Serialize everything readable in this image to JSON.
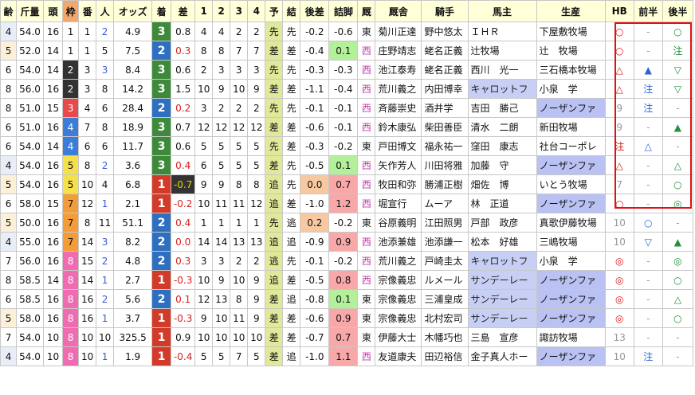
{
  "headers": [
    "齢",
    "斤量",
    "頭",
    "枠",
    "番",
    "人",
    "オッズ",
    "着",
    "差",
    "1",
    "2",
    "3",
    "4",
    "予",
    "結",
    "後差",
    "詰脚",
    "厩",
    "厩舎",
    "騎手",
    "馬主",
    "生産",
    "HB",
    "前半",
    "後半"
  ],
  "rows": [
    {
      "age": "4",
      "kin": "54.0",
      "to": "16",
      "waku": "1",
      "ban": "1",
      "nin": "2",
      "odds": "4.9",
      "chaku": "3",
      "sa": "0.8",
      "c1": "4",
      "c2": "4",
      "c3": "2",
      "c4": "2",
      "yo": "先",
      "ke": "先",
      "kosa": "-0.2",
      "tsume": "-0.6",
      "umaya": "東",
      "kyu": "菊川正達",
      "kishu": "野中悠太",
      "banushi": "ＩＨＲ",
      "seisan": "下屋敷牧場",
      "hb": "○",
      "zen": "-",
      "kou": "○"
    },
    {
      "age": "5",
      "kin": "52.0",
      "to": "14",
      "waku": "1",
      "ban": "1",
      "nin": "5",
      "odds": "7.5",
      "chaku": "2",
      "sa": "0.3",
      "c1": "8",
      "c2": "8",
      "c3": "7",
      "c4": "7",
      "yo": "差",
      "ke": "差",
      "kosa": "-0.4",
      "tsume": "0.1",
      "umaya": "西",
      "kyu": "庄野靖志",
      "kishu": "蛯名正義",
      "banushi": "辻牧場",
      "seisan": "辻　牧場",
      "hb": "○",
      "zen": "-",
      "kou": "注"
    },
    {
      "age": "6",
      "kin": "54.0",
      "to": "14",
      "waku": "2",
      "ban": "3",
      "nin": "3",
      "odds": "8.4",
      "chaku": "3",
      "sa": "0.6",
      "c1": "2",
      "c2": "3",
      "c3": "3",
      "c4": "3",
      "yo": "先",
      "ke": "先",
      "kosa": "-0.3",
      "tsume": "-0.3",
      "umaya": "西",
      "kyu": "池江泰寿",
      "kishu": "蛯名正義",
      "banushi": "西川　光一",
      "seisan": "三石橋本牧場",
      "hb": "△",
      "zen": "▲",
      "kou": "▽"
    },
    {
      "age": "8",
      "kin": "56.0",
      "to": "16",
      "waku": "2",
      "ban": "3",
      "nin": "8",
      "odds": "14.2",
      "chaku": "3",
      "sa": "1.5",
      "c1": "10",
      "c2": "9",
      "c3": "10",
      "c4": "9",
      "yo": "差",
      "ke": "差",
      "kosa": "-1.1",
      "tsume": "-0.4",
      "umaya": "西",
      "kyu": "荒川義之",
      "kishu": "内田博幸",
      "banushi": "キャロットフ",
      "seisan": "小泉　学",
      "hb": "△",
      "zen": "注",
      "kou": "▽"
    },
    {
      "age": "8",
      "kin": "51.0",
      "to": "15",
      "waku": "3",
      "ban": "4",
      "nin": "6",
      "odds": "28.4",
      "chaku": "2",
      "sa": "0.2",
      "c1": "3",
      "c2": "2",
      "c3": "2",
      "c4": "2",
      "yo": "先",
      "ke": "先",
      "kosa": "-0.1",
      "tsume": "-0.1",
      "umaya": "西",
      "kyu": "斉藤崇史",
      "kishu": "酒井学",
      "banushi": "吉田　勝己",
      "seisan": "ノーザンファ",
      "hb": "9",
      "zen": "注",
      "kou": "-"
    },
    {
      "age": "6",
      "kin": "51.0",
      "to": "16",
      "waku": "4",
      "ban": "7",
      "nin": "8",
      "odds": "18.9",
      "chaku": "3",
      "sa": "0.7",
      "c1": "12",
      "c2": "12",
      "c3": "12",
      "c4": "12",
      "yo": "差",
      "ke": "差",
      "kosa": "-0.6",
      "tsume": "-0.1",
      "umaya": "西",
      "kyu": "鈴木康弘",
      "kishu": "柴田善臣",
      "banushi": "清水　二朗",
      "seisan": "新田牧場",
      "hb": "9",
      "zen": "-",
      "kou": "▲"
    },
    {
      "age": "6",
      "kin": "54.0",
      "to": "14",
      "waku": "4",
      "ban": "6",
      "nin": "6",
      "odds": "11.7",
      "chaku": "3",
      "sa": "0.6",
      "c1": "5",
      "c2": "5",
      "c3": "5",
      "c4": "5",
      "yo": "先",
      "ke": "差",
      "kosa": "-0.3",
      "tsume": "-0.2",
      "umaya": "東",
      "kyu": "戸田博文",
      "kishu": "福永祐一",
      "banushi": "窪田　康志",
      "seisan": "社台コーポレ",
      "hb": "注",
      "zen": "△",
      "kou": "-"
    },
    {
      "age": "4",
      "kin": "54.0",
      "to": "16",
      "waku": "5",
      "ban": "8",
      "nin": "2",
      "odds": "3.6",
      "chaku": "3",
      "sa": "0.4",
      "c1": "6",
      "c2": "5",
      "c3": "5",
      "c4": "5",
      "yo": "差",
      "ke": "先",
      "kosa": "-0.5",
      "tsume": "0.1",
      "umaya": "西",
      "kyu": "矢作芳人",
      "kishu": "川田将雅",
      "banushi": "加藤　守",
      "seisan": "ノーザンファ",
      "hb": "△",
      "zen": "-",
      "kou": "△"
    },
    {
      "age": "5",
      "kin": "54.0",
      "to": "16",
      "waku": "5",
      "ban": "10",
      "nin": "4",
      "odds": "6.8",
      "chaku": "1",
      "sa": "-0.7",
      "c1": "9",
      "c2": "9",
      "c3": "8",
      "c4": "8",
      "yo": "追",
      "ke": "先",
      "kosa": "0.0",
      "tsume": "0.7",
      "umaya": "西",
      "kyu": "牧田和弥",
      "kishu": "勝浦正樹",
      "banushi": "畑佐　博",
      "seisan": "いとう牧場",
      "hb": "7",
      "zen": "-",
      "kou": "○"
    },
    {
      "age": "6",
      "kin": "58.0",
      "to": "15",
      "waku": "7",
      "ban": "12",
      "nin": "1",
      "odds": "2.1",
      "chaku": "1",
      "sa": "-0.2",
      "c1": "10",
      "c2": "11",
      "c3": "11",
      "c4": "12",
      "yo": "追",
      "ke": "差",
      "kosa": "-1.0",
      "tsume": "1.2",
      "umaya": "西",
      "kyu": "堀宣行",
      "kishu": "ムーア",
      "banushi": "林　正道",
      "seisan": "ノーザンファ",
      "hb": "○",
      "zen": "-",
      "kou": "◎"
    },
    {
      "age": "5",
      "kin": "50.0",
      "to": "16",
      "waku": "7",
      "ban": "8",
      "nin": "11",
      "odds": "51.1",
      "chaku": "2",
      "sa": "0.4",
      "c1": "1",
      "c2": "1",
      "c3": "1",
      "c4": "1",
      "yo": "先",
      "ke": "逃",
      "kosa": "0.2",
      "tsume": "-0.2",
      "umaya": "東",
      "kyu": "谷原義明",
      "kishu": "江田照男",
      "banushi": "戸部　政彦",
      "seisan": "真歌伊藤牧場",
      "hb": "10",
      "zen": "○",
      "kou": "-"
    },
    {
      "age": "4",
      "kin": "55.0",
      "to": "16",
      "waku": "7",
      "ban": "14",
      "nin": "3",
      "odds": "8.2",
      "chaku": "2",
      "sa": "0.0",
      "c1": "14",
      "c2": "14",
      "c3": "13",
      "c4": "13",
      "yo": "追",
      "ke": "追",
      "kosa": "-0.9",
      "tsume": "0.9",
      "umaya": "西",
      "kyu": "池添兼雄",
      "kishu": "池添謙一",
      "banushi": "松本　好雄",
      "seisan": "三嶋牧場",
      "hb": "10",
      "zen": "▽",
      "kou": "▲"
    },
    {
      "age": "7",
      "kin": "56.0",
      "to": "16",
      "waku": "8",
      "ban": "15",
      "nin": "2",
      "odds": "4.8",
      "chaku": "2",
      "sa": "0.3",
      "c1": "3",
      "c2": "3",
      "c3": "2",
      "c4": "2",
      "yo": "逃",
      "ke": "先",
      "kosa": "-0.1",
      "tsume": "-0.2",
      "umaya": "西",
      "kyu": "荒川義之",
      "kishu": "戸崎圭太",
      "banushi": "キャロットフ",
      "seisan": "小泉　学",
      "hb": "◎",
      "zen": "-",
      "kou": "◎"
    },
    {
      "age": "8",
      "kin": "58.5",
      "to": "14",
      "waku": "8",
      "ban": "14",
      "nin": "1",
      "odds": "2.7",
      "chaku": "1",
      "sa": "-0.3",
      "c1": "10",
      "c2": "9",
      "c3": "10",
      "c4": "9",
      "yo": "追",
      "ke": "差",
      "kosa": "-0.5",
      "tsume": "0.8",
      "umaya": "西",
      "kyu": "宗像義忠",
      "kishu": "ルメール",
      "banushi": "サンデーレー",
      "seisan": "ノーザンファ",
      "hb": "◎",
      "zen": "-",
      "kou": "○"
    },
    {
      "age": "6",
      "kin": "58.5",
      "to": "16",
      "waku": "8",
      "ban": "16",
      "nin": "2",
      "odds": "5.6",
      "chaku": "2",
      "sa": "0.1",
      "c1": "12",
      "c2": "13",
      "c3": "8",
      "c4": "9",
      "yo": "差",
      "ke": "追",
      "kosa": "-0.8",
      "tsume": "0.1",
      "umaya": "東",
      "kyu": "宗像義忠",
      "kishu": "三浦皇成",
      "banushi": "サンデーレー",
      "seisan": "ノーザンファ",
      "hb": "◎",
      "zen": "-",
      "kou": "△"
    },
    {
      "age": "5",
      "kin": "58.0",
      "to": "16",
      "waku": "8",
      "ban": "16",
      "nin": "1",
      "odds": "3.7",
      "chaku": "1",
      "sa": "-0.3",
      "c1": "9",
      "c2": "10",
      "c3": "11",
      "c4": "9",
      "yo": "差",
      "ke": "差",
      "kosa": "-0.6",
      "tsume": "0.9",
      "umaya": "東",
      "kyu": "宗像義忠",
      "kishu": "北村宏司",
      "banushi": "サンデーレー",
      "seisan": "ノーザンファ",
      "hb": "◎",
      "zen": "-",
      "kou": "○"
    },
    {
      "age": "7",
      "kin": "54.0",
      "to": "10",
      "waku": "8",
      "ban": "10",
      "nin": "10",
      "odds": "325.5",
      "chaku": "1",
      "sa": "0.9",
      "c1": "10",
      "c2": "10",
      "c3": "10",
      "c4": "10",
      "yo": "差",
      "ke": "差",
      "kosa": "-0.7",
      "tsume": "0.7",
      "umaya": "東",
      "kyu": "伊藤大士",
      "kishu": "木幡巧也",
      "banushi": "三島　宣彦",
      "seisan": "諏訪牧場",
      "hb": "13",
      "zen": "-",
      "kou": "-"
    },
    {
      "age": "4",
      "kin": "54.0",
      "to": "10",
      "waku": "8",
      "ban": "10",
      "nin": "1",
      "odds": "1.9",
      "chaku": "1",
      "sa": "-0.4",
      "c1": "5",
      "c2": "5",
      "c3": "7",
      "c4": "5",
      "yo": "差",
      "ke": "追",
      "kosa": "-1.0",
      "tsume": "1.1",
      "umaya": "西",
      "kyu": "友道康夫",
      "kishu": "田辺裕信",
      "banushi": "金子真人ホー",
      "seisan": "ノーザンファ",
      "hb": "10",
      "zen": "注",
      "kou": "-"
    }
  ]
}
